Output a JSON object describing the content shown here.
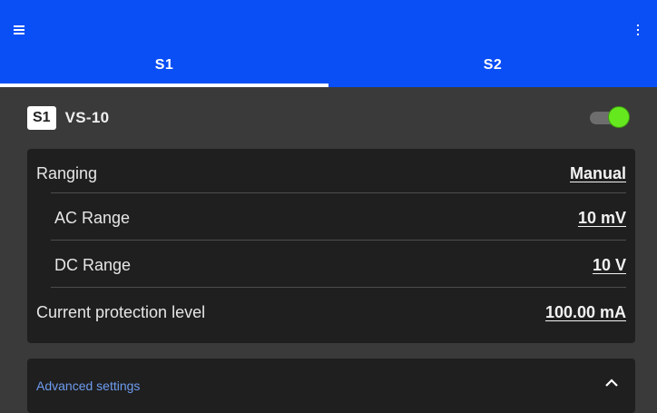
{
  "appbar": {
    "menu_icon": "hamburger-menu-icon",
    "more_icon": "more-vert-icon",
    "color": "#0a4ff5"
  },
  "tabs": [
    {
      "label": "S1",
      "active": true
    },
    {
      "label": "S2",
      "active": false
    }
  ],
  "device": {
    "badge": "S1",
    "name": "VS-10",
    "enabled": true,
    "toggle_color": "#66e81f"
  },
  "settings": {
    "ranging": {
      "label": "Ranging",
      "value": "Manual"
    },
    "ac_range": {
      "label": "AC Range",
      "value": "10 mV"
    },
    "dc_range": {
      "label": "DC Range",
      "value": "10 V"
    },
    "current_protection": {
      "label": "Current protection level",
      "value": "100.00 mA"
    }
  },
  "advanced": {
    "label": "Advanced settings",
    "icon": "chevron-up-icon",
    "expanded": true
  }
}
